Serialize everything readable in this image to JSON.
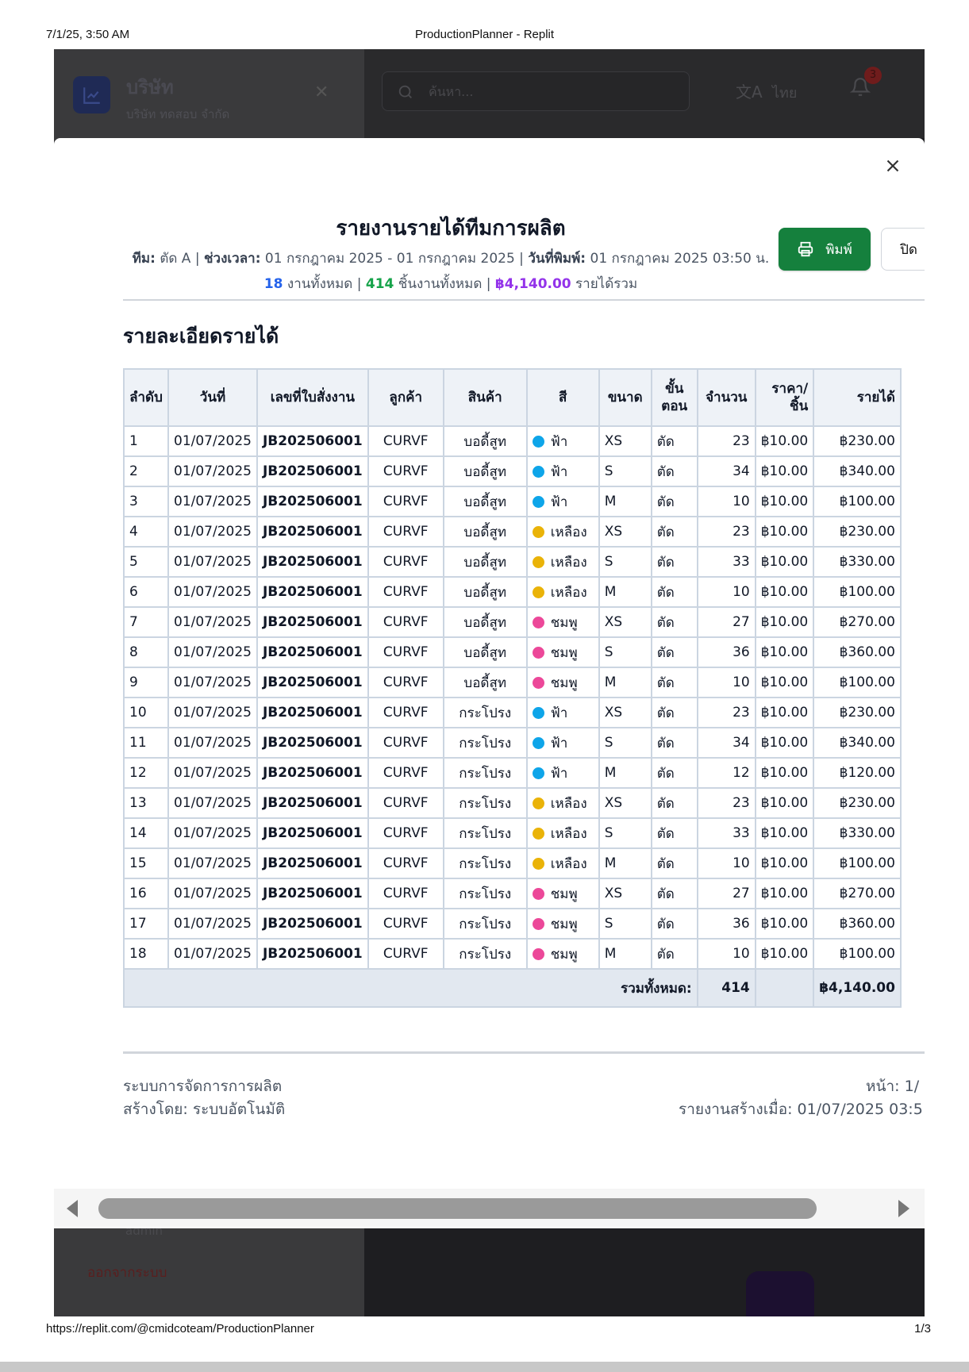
{
  "print": {
    "datetime": "7/1/25, 3:50 AM",
    "window_title": "ProductionPlanner - Replit",
    "url": "https://replit.com/@cmidcoteam/ProductionPlanner",
    "page": "1/3"
  },
  "app": {
    "company_name": "บริษัท",
    "company_sub": "บริษัท ทดสอบ จำกัด",
    "search_placeholder": "ค้นหา...",
    "language": "ไทย",
    "notification_count": "3",
    "user": "admin",
    "logout": "ออกจากระบบ"
  },
  "report": {
    "title": "รายงานรายได้ทีมการผลิต",
    "meta": {
      "team_label": "ทีม:",
      "team_value": "ตัด A",
      "period_label": "ช่วงเวลา:",
      "period_value": "01 กรกฎาคม 2025 - 01 กรกฎาคม 2025",
      "printed_label": "วันที่พิมพ์:",
      "printed_value": "01 กรกฎาคม 2025 03:50 น."
    },
    "summary": {
      "jobs": "18",
      "jobs_label": "งานทั้งหมด",
      "pieces": "414",
      "pieces_label": "ชิ้นงานทั้งหมด",
      "revenue": "฿4,140.00",
      "revenue_label": "รายได้รวม"
    },
    "buttons": {
      "print": "พิมพ์",
      "close": "ปิด"
    },
    "section_title": "รายละเอียดรายได้",
    "columns": [
      "ลำดับ",
      "วันที่",
      "เลขที่ใบสั่งงาน",
      "ลูกค้า",
      "สินค้า",
      "สี",
      "ขนาด",
      "ขั้นตอน",
      "จำนวน",
      "ราคา/ชิ้น",
      "รายได้"
    ],
    "colors": {
      "ฟ้า": "#0ea5e9",
      "เหลือง": "#eab308",
      "ชมพู": "#ec4899"
    },
    "rows": [
      [
        "1",
        "01/07/2025",
        "JB202506001",
        "CURVF",
        "บอดี้สูท",
        "ฟ้า",
        "XS",
        "ตัด",
        "23",
        "฿10.00",
        "฿230.00"
      ],
      [
        "2",
        "01/07/2025",
        "JB202506001",
        "CURVF",
        "บอดี้สูท",
        "ฟ้า",
        "S",
        "ตัด",
        "34",
        "฿10.00",
        "฿340.00"
      ],
      [
        "3",
        "01/07/2025",
        "JB202506001",
        "CURVF",
        "บอดี้สูท",
        "ฟ้า",
        "M",
        "ตัด",
        "10",
        "฿10.00",
        "฿100.00"
      ],
      [
        "4",
        "01/07/2025",
        "JB202506001",
        "CURVF",
        "บอดี้สูท",
        "เหลือง",
        "XS",
        "ตัด",
        "23",
        "฿10.00",
        "฿230.00"
      ],
      [
        "5",
        "01/07/2025",
        "JB202506001",
        "CURVF",
        "บอดี้สูท",
        "เหลือง",
        "S",
        "ตัด",
        "33",
        "฿10.00",
        "฿330.00"
      ],
      [
        "6",
        "01/07/2025",
        "JB202506001",
        "CURVF",
        "บอดี้สูท",
        "เหลือง",
        "M",
        "ตัด",
        "10",
        "฿10.00",
        "฿100.00"
      ],
      [
        "7",
        "01/07/2025",
        "JB202506001",
        "CURVF",
        "บอดี้สูท",
        "ชมพู",
        "XS",
        "ตัด",
        "27",
        "฿10.00",
        "฿270.00"
      ],
      [
        "8",
        "01/07/2025",
        "JB202506001",
        "CURVF",
        "บอดี้สูท",
        "ชมพู",
        "S",
        "ตัด",
        "36",
        "฿10.00",
        "฿360.00"
      ],
      [
        "9",
        "01/07/2025",
        "JB202506001",
        "CURVF",
        "บอดี้สูท",
        "ชมพู",
        "M",
        "ตัด",
        "10",
        "฿10.00",
        "฿100.00"
      ],
      [
        "10",
        "01/07/2025",
        "JB202506001",
        "CURVF",
        "กระโปรง",
        "ฟ้า",
        "XS",
        "ตัด",
        "23",
        "฿10.00",
        "฿230.00"
      ],
      [
        "11",
        "01/07/2025",
        "JB202506001",
        "CURVF",
        "กระโปรง",
        "ฟ้า",
        "S",
        "ตัด",
        "34",
        "฿10.00",
        "฿340.00"
      ],
      [
        "12",
        "01/07/2025",
        "JB202506001",
        "CURVF",
        "กระโปรง",
        "ฟ้า",
        "M",
        "ตัด",
        "12",
        "฿10.00",
        "฿120.00"
      ],
      [
        "13",
        "01/07/2025",
        "JB202506001",
        "CURVF",
        "กระโปรง",
        "เหลือง",
        "XS",
        "ตัด",
        "23",
        "฿10.00",
        "฿230.00"
      ],
      [
        "14",
        "01/07/2025",
        "JB202506001",
        "CURVF",
        "กระโปรง",
        "เหลือง",
        "S",
        "ตัด",
        "33",
        "฿10.00",
        "฿330.00"
      ],
      [
        "15",
        "01/07/2025",
        "JB202506001",
        "CURVF",
        "กระโปรง",
        "เหลือง",
        "M",
        "ตัด",
        "10",
        "฿10.00",
        "฿100.00"
      ],
      [
        "16",
        "01/07/2025",
        "JB202506001",
        "CURVF",
        "กระโปรง",
        "ชมพู",
        "XS",
        "ตัด",
        "27",
        "฿10.00",
        "฿270.00"
      ],
      [
        "17",
        "01/07/2025",
        "JB202506001",
        "CURVF",
        "กระโปรง",
        "ชมพู",
        "S",
        "ตัด",
        "36",
        "฿10.00",
        "฿360.00"
      ],
      [
        "18",
        "01/07/2025",
        "JB202506001",
        "CURVF",
        "กระโปรง",
        "ชมพู",
        "M",
        "ตัด",
        "10",
        "฿10.00",
        "฿100.00"
      ]
    ],
    "total": {
      "label": "รวมทั้งหมด:",
      "qty": "414",
      "revenue": "฿4,140.00"
    },
    "footer": {
      "system": "ระบบการจัดการการผลิต",
      "created_by": "สร้างโดย: ระบบอัตโนมัติ",
      "page": "หน้า: 1/",
      "generated": "รายงานสร้างเมื่อ: 01/07/2025 03:5"
    }
  }
}
